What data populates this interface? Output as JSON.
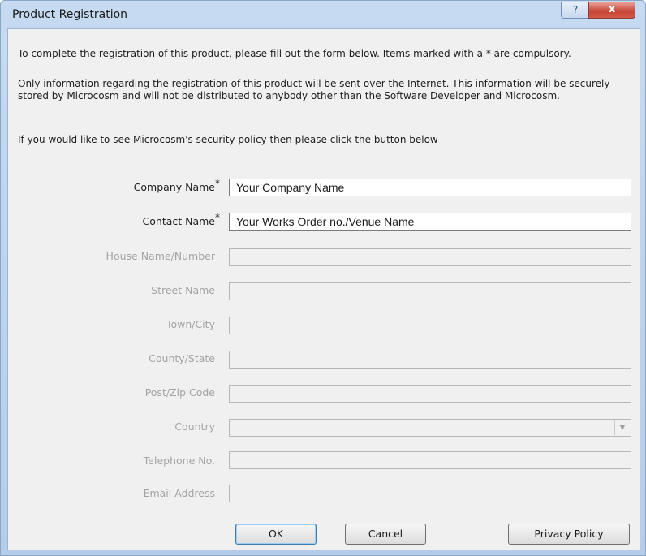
{
  "window": {
    "title": "Product Registration",
    "help_glyph": "?",
    "close_glyph": "x"
  },
  "intro": {
    "line1": "To complete the registration of this product, please fill out the form below. Items marked with a * are compulsory.",
    "line2": "Only information regarding the registration of this product will be sent over the Internet. This information will be securely stored by Microcosm and will not be distributed to anybody other than the Software Developer and Microcosm.",
    "line3": "If you would like to see Microcosm's security policy then please click the button below"
  },
  "form": {
    "company_name": {
      "label": "Company Name",
      "required": "*",
      "value": "Your Company Name"
    },
    "contact_name": {
      "label": "Contact Name",
      "required": "*",
      "value": "Your Works Order no./Venue Name"
    },
    "house": {
      "label": "House Name/Number",
      "value": ""
    },
    "street": {
      "label": "Street Name",
      "value": ""
    },
    "town": {
      "label": "Town/City",
      "value": ""
    },
    "county": {
      "label": "County/State",
      "value": ""
    },
    "post": {
      "label": "Post/Zip Code",
      "value": ""
    },
    "country": {
      "label": "Country",
      "value": "",
      "arrow_glyph": "▼"
    },
    "telephone": {
      "label": "Telephone No.",
      "value": ""
    },
    "email": {
      "label": "Email Address",
      "value": ""
    }
  },
  "buttons": {
    "ok": "OK",
    "cancel": "Cancel",
    "privacy": "Privacy Policy"
  }
}
